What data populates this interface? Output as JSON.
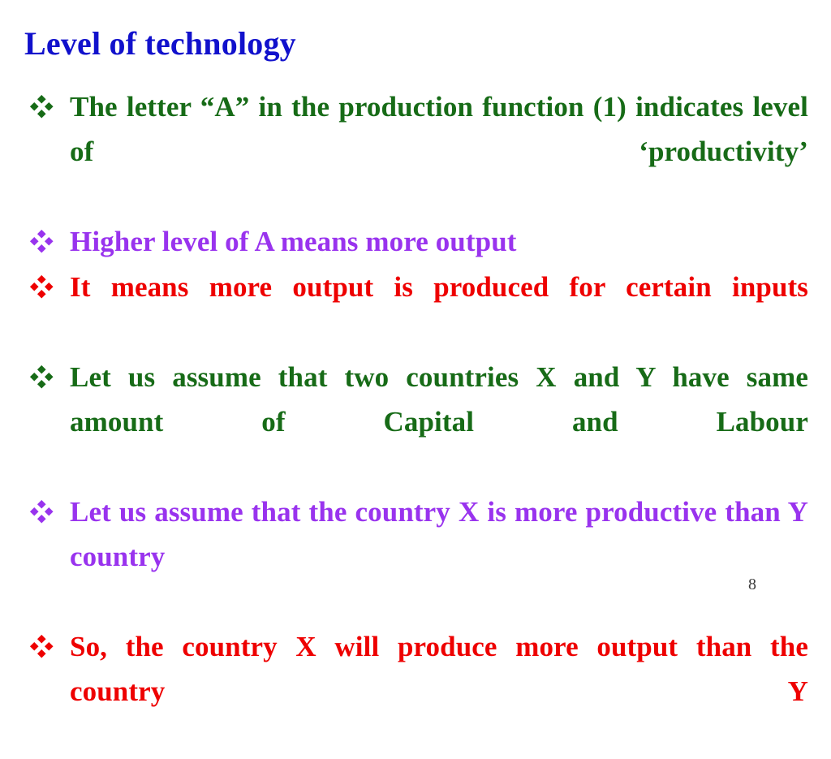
{
  "slide": {
    "title": "Level of technology",
    "title_color": "#1111cc",
    "background_color": "#ffffff",
    "page_number": "8",
    "bullet_icon": "four-diamond-bullet",
    "bullets": [
      {
        "text": "The letter “A” in the production function (1) indicates level of ‘productivity’",
        "color": "#176b17",
        "justified": true
      },
      {
        "text": "Higher level of A means more output",
        "color": "#9933ee",
        "justified": false
      },
      {
        "text": "It means more output is produced for certain inputs",
        "color": "#ee0000",
        "justified": true
      },
      {
        "text": "Let us assume that two countries X and Y have same amount of Capital and Labour",
        "color": "#176b17",
        "justified": true
      },
      {
        "text": "Let us assume that the country X is more productive than Y country",
        "color": "#9933ee",
        "justified": true
      },
      {
        "text": "So, the country X will produce more output than the country Y",
        "color": "#ee0000",
        "justified": true
      }
    ]
  }
}
